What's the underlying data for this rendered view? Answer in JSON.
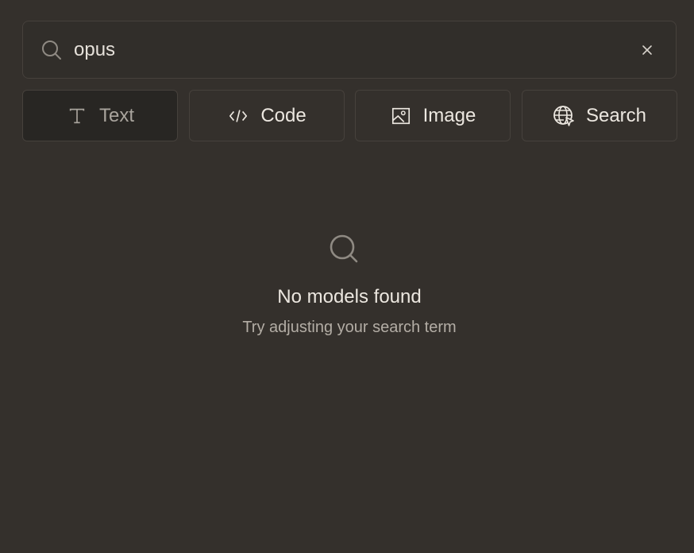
{
  "search": {
    "value": "opus",
    "clear_label": "×"
  },
  "tabs": [
    {
      "label": "Text",
      "icon": "text-icon",
      "active": true
    },
    {
      "label": "Code",
      "icon": "code-icon",
      "active": false
    },
    {
      "label": "Image",
      "icon": "image-icon",
      "active": false
    },
    {
      "label": "Search",
      "icon": "globe-icon",
      "active": false
    }
  ],
  "empty_state": {
    "icon": "search-icon",
    "title": "No models found",
    "subtitle": "Try adjusting your search term"
  },
  "colors": {
    "background": "#34302c",
    "border": "#46413c",
    "text": "#ece7e0",
    "muted": "#b3ada5",
    "active_tab": "#282623"
  }
}
